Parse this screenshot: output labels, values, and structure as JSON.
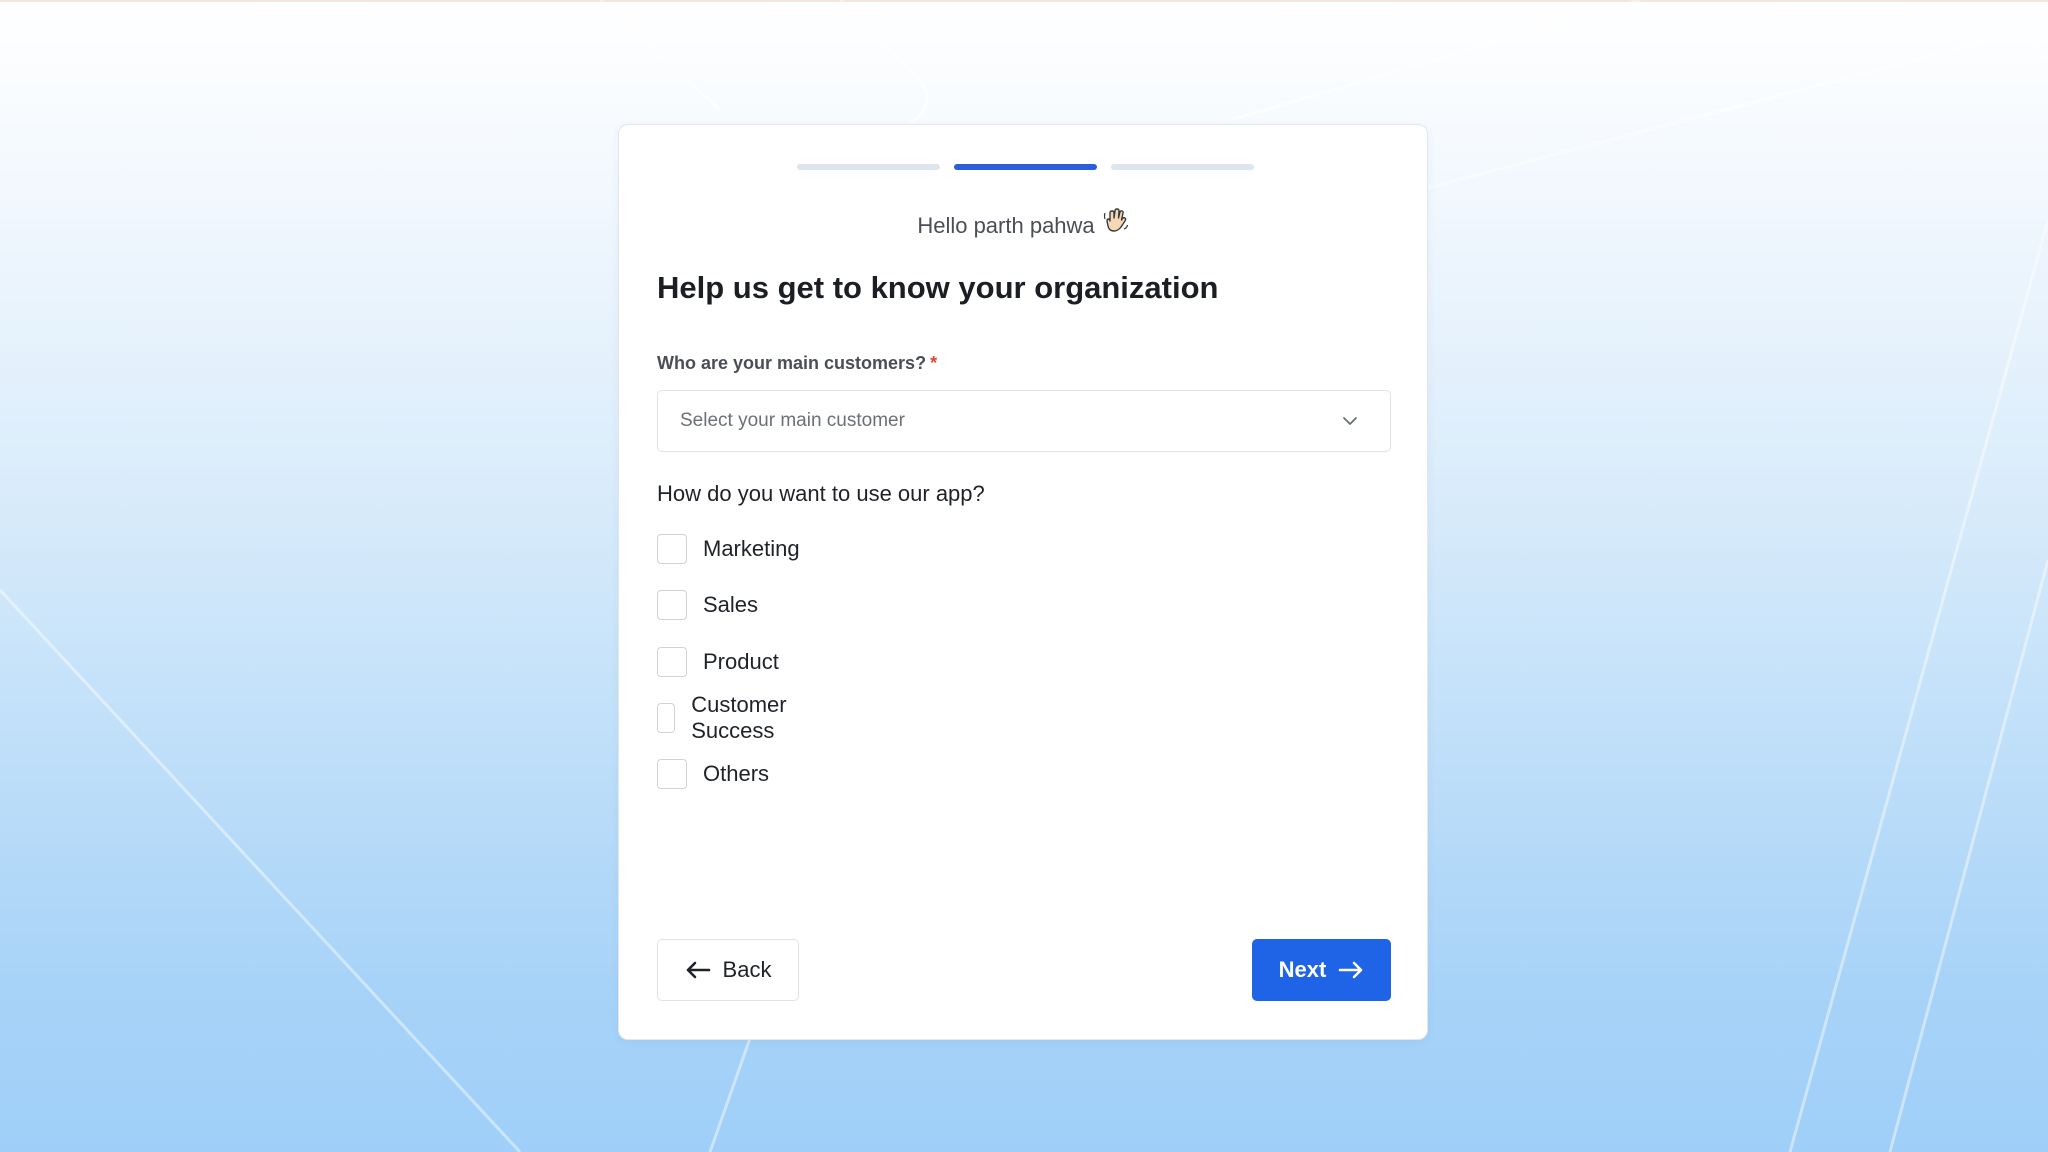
{
  "header": {
    "progress_steps": 3,
    "progress_current_step": 2,
    "greeting": "Hello parth pahwa",
    "greeting_icon": "waving-hand-icon"
  },
  "form": {
    "title": "Help us get to know your organization",
    "customers_label": "Who are your main customers?",
    "required_marker": "*",
    "customers_placeholder": "Select your main customer",
    "usage_question": "How do you want to use our app?",
    "usage_options": [
      {
        "label": "Marketing",
        "checked": false
      },
      {
        "label": "Sales",
        "checked": false
      },
      {
        "label": "Product",
        "checked": false
      },
      {
        "label": "Customer Success",
        "checked": false
      },
      {
        "label": "Others",
        "checked": false
      }
    ]
  },
  "footer": {
    "back_label": "Back",
    "next_label": "Next"
  },
  "colors": {
    "primary": "#1f63e6",
    "progress_active": "#2b5fd9",
    "progress_inactive": "#dde5ef",
    "required": "#e0453a"
  }
}
